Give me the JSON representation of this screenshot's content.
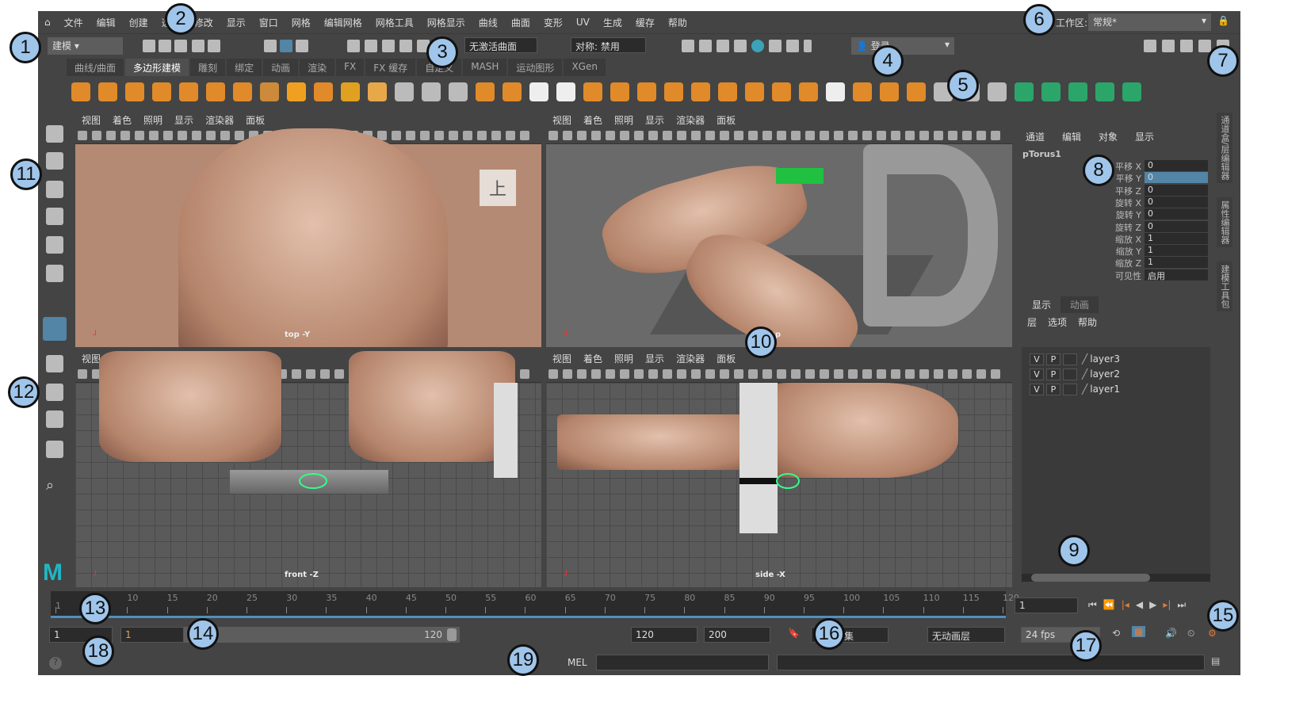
{
  "menu": {
    "items": [
      "文件",
      "编辑",
      "创建",
      "选择",
      "修改",
      "显示",
      "窗口",
      "网格",
      "编辑网格",
      "网格工具",
      "网格显示",
      "曲线",
      "曲面",
      "变形",
      "UV",
      "生成",
      "缓存",
      "帮助"
    ]
  },
  "status": {
    "mode": "建模",
    "live_surface": "无激活曲面",
    "symmetry": "对称: 禁用",
    "login": "登录",
    "workspace_label": "工作区:",
    "workspace": "常规*"
  },
  "shelf_tabs": [
    "曲线/曲面",
    "多边形建模",
    "雕刻",
    "绑定",
    "动画",
    "渲染",
    "FX",
    "FX 缓存",
    "自定义",
    "MASH",
    "运动图形",
    "XGen"
  ],
  "viewport_menu": [
    "视图",
    "着色",
    "照明",
    "显示",
    "渲染器",
    "面板"
  ],
  "viewports": [
    {
      "camera": "top -Y",
      "label": "上"
    },
    {
      "camera": "persp"
    },
    {
      "camera": "front -Z"
    },
    {
      "camera": "side -X"
    }
  ],
  "channel_box": {
    "menu": [
      "通道",
      "编辑",
      "对象",
      "显示"
    ],
    "object": "pTorus1",
    "attrs": [
      {
        "name": "平移 X",
        "value": "0"
      },
      {
        "name": "平移 Y",
        "value": "0"
      },
      {
        "name": "平移 Z",
        "value": "0"
      },
      {
        "name": "旋转 X",
        "value": "0"
      },
      {
        "name": "旋转 Y",
        "value": "0"
      },
      {
        "name": "旋转 Z",
        "value": "0"
      },
      {
        "name": "缩放 X",
        "value": "1"
      },
      {
        "name": "缩放 Y",
        "value": "1"
      },
      {
        "name": "缩放 Z",
        "value": "1"
      },
      {
        "name": "可见性",
        "value": "启用"
      }
    ]
  },
  "layer_editor": {
    "tabs": [
      "显示",
      "动画"
    ],
    "menu": [
      "层",
      "选项",
      "帮助"
    ],
    "layers": [
      {
        "v": "V",
        "p": "P",
        "name": "layer3"
      },
      {
        "v": "V",
        "p": "P",
        "name": "layer2"
      },
      {
        "v": "V",
        "p": "P",
        "name": "layer1"
      }
    ]
  },
  "side_tabs": [
    "通道盒/层编辑器",
    "属性编辑器",
    "建模工具包"
  ],
  "timeline": {
    "ticks": [
      "1",
      "5",
      "10",
      "15",
      "20",
      "25",
      "30",
      "35",
      "40",
      "45",
      "50",
      "55",
      "60",
      "65",
      "70",
      "75",
      "80",
      "85",
      "90",
      "95",
      "100",
      "105",
      "110",
      "115",
      "120"
    ],
    "current_frame": "1"
  },
  "range": {
    "start": "1",
    "range_start": "1",
    "range_end": "120",
    "end": "120",
    "max": "200",
    "character_set": "无角色集",
    "anim_layer": "无动画层",
    "fps": "24 fps"
  },
  "command": {
    "lang": "MEL"
  },
  "callouts": [
    "1",
    "2",
    "3",
    "4",
    "5",
    "6",
    "7",
    "8",
    "9",
    "10",
    "11",
    "12",
    "13",
    "14",
    "15",
    "16",
    "17",
    "18",
    "19"
  ],
  "colors": {
    "accent": "#5285a6",
    "skin": "#c89a82",
    "timeline_bar": "#4f8fbf"
  }
}
